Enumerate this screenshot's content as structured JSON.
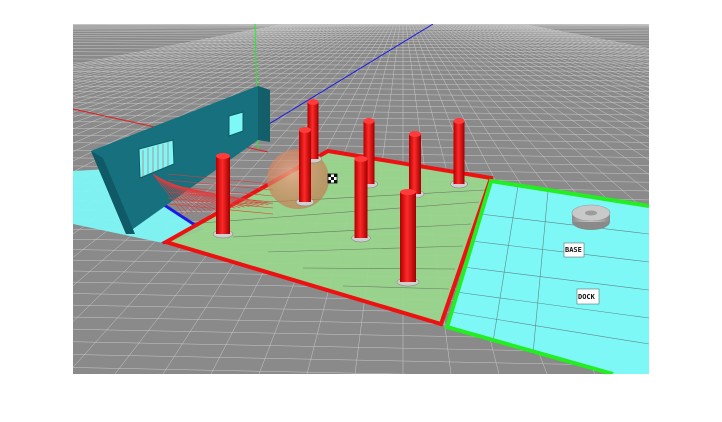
{
  "scene": {
    "background_color": "#8a8a8a",
    "grid_line_color": "#c8c8c8",
    "regions": [
      {
        "name": "left-strip",
        "fill": "#7ef7f7",
        "border": "#1a1ae6"
      },
      {
        "name": "obstacle-field",
        "fill": "#9ad68c",
        "border": "#ee1111"
      },
      {
        "name": "target-zone",
        "fill": "#7ef7f7",
        "border": "#22ee22"
      }
    ],
    "wall_color": "#17707e",
    "pillar_color": "#ee1111",
    "pillar_count": 8,
    "robot_color": "#b5b5b5",
    "marker_labels": [
      "BASE",
      "DOCK"
    ],
    "axes": {
      "x_color": "#e61a1a",
      "y_color": "#22ee22",
      "z_color": "#1a1ae6"
    }
  }
}
